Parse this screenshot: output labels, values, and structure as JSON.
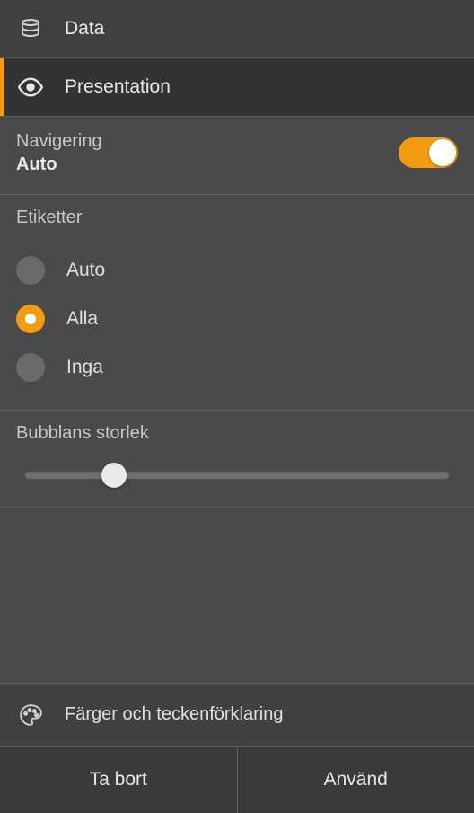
{
  "tabs": {
    "data": {
      "label": "Data"
    },
    "presentation": {
      "label": "Presentation"
    }
  },
  "nav": {
    "label": "Navigering",
    "value": "Auto",
    "enabled": true
  },
  "labels": {
    "title": "Etiketter",
    "options": [
      {
        "label": "Auto",
        "selected": false
      },
      {
        "label": "Alla",
        "selected": true
      },
      {
        "label": "Inga",
        "selected": false
      }
    ]
  },
  "bubbleSize": {
    "title": "Bubblans storlek",
    "valuePercent": 21
  },
  "colors": {
    "label": "Färger och teckenförklaring"
  },
  "footer": {
    "remove": "Ta bort",
    "apply": "Använd"
  },
  "accent": "#f39c12"
}
